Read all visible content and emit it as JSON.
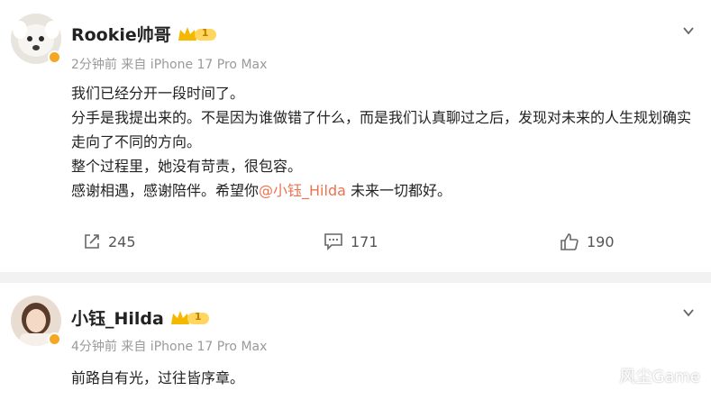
{
  "post1": {
    "username": "Rookie帅哥",
    "level": "1",
    "meta": "2分钟前 来自 iPhone 17 Pro Max",
    "paragraphs": [
      "我们已经分开一段时间了。",
      "分手是我提出来的。不是因为谁做错了什么，而是我们认真聊过之后，发现对未来的人生规划确实走向了不同的方向。",
      "整个过程里，她没有苛责，很包容。"
    ],
    "last_line_prefix": "感谢相遇，感谢陪伴。希望你",
    "mention": "@小钰_Hilda",
    "last_line_suffix": " 未来一切都好。",
    "repost_count": "245",
    "comment_count": "171",
    "like_count": "190"
  },
  "post2": {
    "username": "小钰_Hilda",
    "level": "1",
    "meta": "4分钟前 来自 iPhone 17 Pro Max",
    "text": "前路自有光，过往皆序章。"
  },
  "watermark": "风尘Game",
  "colors": {
    "mention": "#eb7350",
    "vip_gold": "#f5a623"
  },
  "icons": [
    "chevron-down-icon",
    "repost-icon",
    "comment-icon",
    "like-icon",
    "crown-icon"
  ]
}
